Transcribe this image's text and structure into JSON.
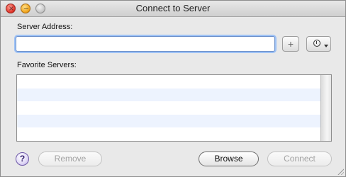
{
  "window": {
    "title": "Connect to Server"
  },
  "form": {
    "server_address_label": "Server Address:",
    "server_address_value": "",
    "add_button_glyph": "+",
    "favorites_label": "Favorite Servers:",
    "favorites": []
  },
  "buttons": {
    "help": "?",
    "remove": "Remove",
    "browse": "Browse",
    "connect": "Connect"
  },
  "icons": {
    "recent_servers": "clock-icon"
  }
}
